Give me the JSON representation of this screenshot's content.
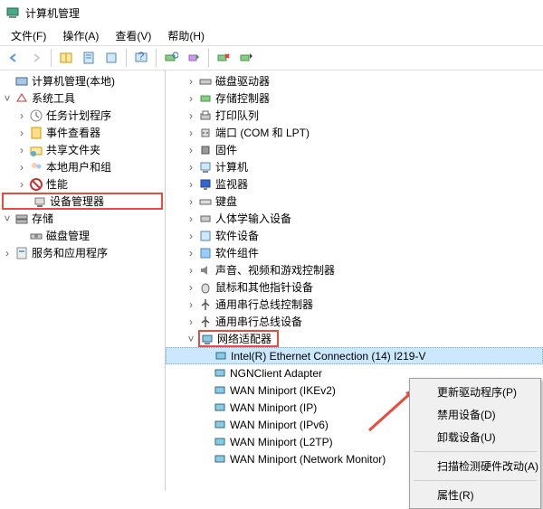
{
  "window": {
    "title": "计算机管理"
  },
  "menu": {
    "file": "文件(F)",
    "action": "操作(A)",
    "view": "查看(V)",
    "help": "帮助(H)"
  },
  "left_tree": {
    "root": "计算机管理(本地)",
    "system_tools": "系统工具",
    "task_scheduler": "任务计划程序",
    "event_viewer": "事件查看器",
    "shared_folders": "共享文件夹",
    "local_users": "本地用户和组",
    "performance": "性能",
    "device_manager": "设备管理器",
    "storage": "存储",
    "disk_management": "磁盘管理",
    "services": "服务和应用程序"
  },
  "right_tree": {
    "disk_drives": "磁盘驱动器",
    "storage_controllers": "存储控制器",
    "print_queues": "打印队列",
    "ports": "端口 (COM 和 LPT)",
    "firmware": "固件",
    "computer": "计算机",
    "monitors": "监视器",
    "keyboards": "键盘",
    "hid": "人体学输入设备",
    "software_devices": "软件设备",
    "software_components": "软件组件",
    "sound": "声音、视频和游戏控制器",
    "mice": "鼠标和其他指针设备",
    "usb_controllers": "通用串行总线控制器",
    "usb_devices": "通用串行总线设备",
    "network_adapters": "网络适配器",
    "net_ethernet": "Intel(R) Ethernet Connection (14) I219-V",
    "net_ngn": "NGNClient Adapter",
    "net_wan_ikev2": "WAN Miniport (IKEv2)",
    "net_wan_ip": "WAN Miniport (IP)",
    "net_wan_ipv6": "WAN Miniport (IPv6)",
    "net_wan_l2tp": "WAN Miniport (L2TP)",
    "net_wan_netmon": "WAN Miniport (Network Monitor)"
  },
  "context_menu": {
    "update_driver": "更新驱动程序(P)",
    "disable_device": "禁用设备(D)",
    "uninstall_device": "卸载设备(U)",
    "scan_hardware": "扫描检测硬件改动(A)",
    "properties": "属性(R)"
  }
}
